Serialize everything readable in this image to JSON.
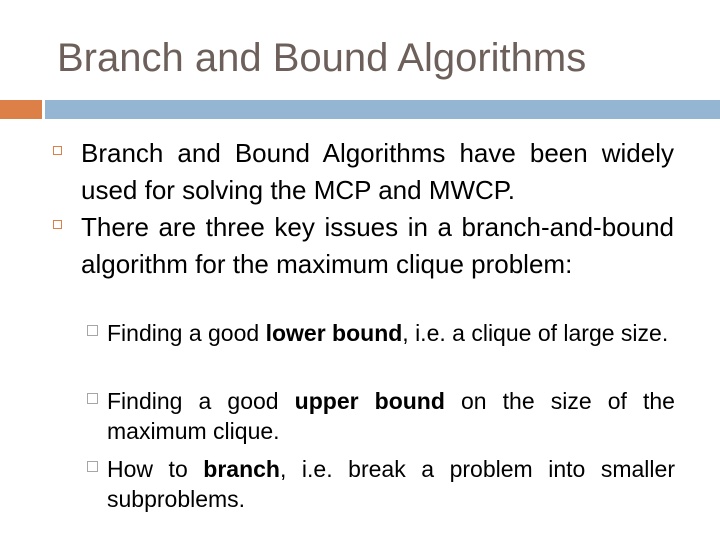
{
  "slide": {
    "title": "Branch and Bound Algorithms",
    "colors": {
      "title": "#6d5f5a",
      "accent_bar": "#dd8047",
      "main_bar": "#94b6d2",
      "level1_bullet": "#dd8047",
      "level2_bullet": "#a6a6a6",
      "body_text": "#000000"
    },
    "bullets": [
      {
        "level": 1,
        "icon": "hollow-square-bullet",
        "text": "Branch and Bound Algorithms have been widely used for solving the MCP and MWCP."
      },
      {
        "level": 1,
        "icon": "hollow-square-bullet",
        "text": "There are three key issues in a branch-and-bound algorithm for the maximum clique problem:"
      }
    ],
    "sub_bullets": [
      {
        "level": 2,
        "icon": "hollow-square-bullet",
        "before": "Finding a good ",
        "bold": "lower bound",
        "after": ", i.e. a clique of large size."
      },
      {
        "level": 2,
        "icon": "hollow-square-bullet",
        "before": "Finding a good ",
        "bold": "upper bound",
        "after": " on the size of the maximum clique."
      },
      {
        "level": 2,
        "icon": "hollow-square-bullet",
        "before": "How to ",
        "bold": "branch",
        "after": ", i.e. break a problem into smaller subproblems."
      }
    ]
  }
}
